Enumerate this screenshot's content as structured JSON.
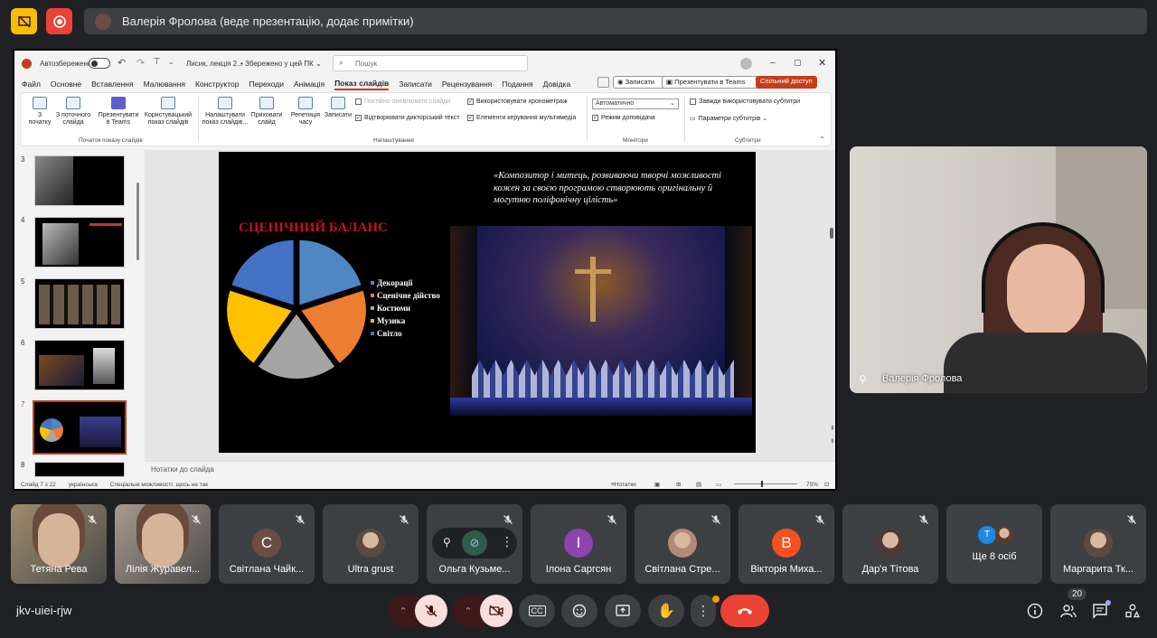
{
  "topbar": {
    "presenter_text": "Валерія Фролова (веде презентацію, додає примітки)"
  },
  "ppt": {
    "autosave_label": "Автозбереження",
    "file_name": "Лисик, лекція 2...",
    "saved_status": "• Збережено у цей ПК ⌄",
    "search_placeholder": "Пошук",
    "menu": [
      "Файл",
      "Основне",
      "Вставлення",
      "Малювання",
      "Конструктор",
      "Переходи",
      "Анімація",
      "Показ слайдів",
      "Записати",
      "Рецензування",
      "Подання",
      "Довідка"
    ],
    "record_btn": "Записати",
    "teams_btn": "Презентувати в Teams",
    "share_btn": "Спільний доступ",
    "ribbon": {
      "from_start": "З початку",
      "from_current": "З поточного слайда",
      "present_teams": "Презентувати в Teams",
      "custom_show": "Користувацький показ слайдів",
      "group_start": "Початок показу слайдів",
      "setup_show": "Налаштувати показ слайдів...",
      "hide_slide": "Приховати слайд",
      "rehearse": "Репетиція часу",
      "record": "Записати",
      "loop_updated": "Постійно оновлювати слайди",
      "play_narration": "Відтворювати дикторський текст",
      "use_timings": "Використовувати хронометраж",
      "media_controls": "Елементи керування мультимедіа",
      "group_setup": "Налаштування",
      "monitor_value": "Автоматично",
      "presenter_view": "Режим доповідача",
      "group_monitors": "Монітори",
      "always_subtitles": "Завжди використовувати субтитри",
      "subtitle_settings": "Параметри субтитрів",
      "group_subtitles": "Субтитри"
    },
    "thumb_numbers": [
      "3",
      "4",
      "5",
      "6",
      "7",
      "8"
    ],
    "slide": {
      "quote": "«Композитор і митець, розвиваючи творчі можливості кожен за своєю програмою створюють оригінальну й могутню поліфонічну цілість»",
      "chart_title": "СЦЕНІЧНИЙ БАЛАНС",
      "legend": [
        "Декорації",
        "Сценічне дійство",
        "Костюми",
        "Музика",
        "Світло"
      ]
    },
    "notes_label": "Нотатки до слайда",
    "status": {
      "slide_of": "Слайд 7 з 22",
      "language": "українська",
      "accessibility": "Спеціальні можливості: щось не так",
      "notes": "Нотатки",
      "zoom": "75%"
    }
  },
  "chart_data": {
    "type": "pie",
    "title": "СЦЕНІЧНИЙ БАЛАНС",
    "categories": [
      "Декорації",
      "Сценічне дійство",
      "Костюми",
      "Музика",
      "Світло"
    ],
    "values": [
      20,
      20,
      20,
      20,
      20
    ],
    "colors": [
      "#4f86c6",
      "#ed7d31",
      "#a5a5a5",
      "#ffc000",
      "#4472c4"
    ],
    "legend_position": "right"
  },
  "video": {
    "name": "Валерія Фролова"
  },
  "participants": [
    {
      "name": "Тетяна Рева",
      "type": "photo",
      "color": "#9e8c6e"
    },
    {
      "name": "Лілія Журавел...",
      "type": "photo",
      "color": "#a89a8e"
    },
    {
      "name": "Світлана Чайк...",
      "type": "letter",
      "letter": "С",
      "color": "#6d4c41"
    },
    {
      "name": "Ultra grust",
      "type": "photo",
      "color": "#5a4a40"
    },
    {
      "name": "Ольга Кузьме...",
      "type": "hover",
      "color": "#2e5c4a"
    },
    {
      "name": "Ілона Саргсян",
      "type": "letter",
      "letter": "І",
      "color": "#8e44ad"
    },
    {
      "name": "Світлана Стре...",
      "type": "photo",
      "color": "#b08a7a"
    },
    {
      "name": "Вікторія Миха...",
      "type": "letter",
      "letter": "В",
      "color": "#f4511e"
    },
    {
      "name": "Дар'я Тітова",
      "type": "photo",
      "color": "#4a3a35"
    },
    {
      "name": "Ще 8 осіб",
      "type": "more",
      "color": "#1e88e5"
    },
    {
      "name": "Маргарита Тк...",
      "type": "photo",
      "color": "#5d4a3f"
    }
  ],
  "more_letter": "T",
  "bottom": {
    "meeting_code": "jkv-uiei-rjw",
    "people_count": "20"
  }
}
